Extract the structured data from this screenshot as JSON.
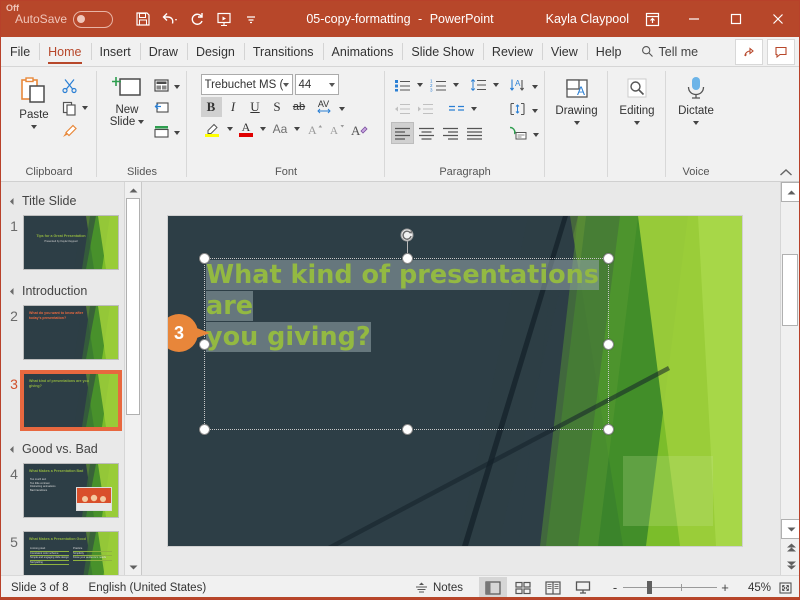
{
  "titlebar": {
    "autosave_label": "AutoSave",
    "autosave_state": "Off",
    "filename": "05-copy-formatting",
    "separator": "-",
    "app_name": "PowerPoint",
    "user_name": "Kayla Claypool",
    "qat": [
      {
        "name": "save-icon",
        "tip": "Save"
      },
      {
        "name": "undo-icon",
        "tip": "Undo"
      },
      {
        "name": "redo-icon",
        "tip": "Redo"
      },
      {
        "name": "start-presentation-icon",
        "tip": "Start From Beginning"
      },
      {
        "name": "customize-qat-icon",
        "tip": "Customize Quick Access Toolbar"
      }
    ],
    "window_buttons": [
      "ribbon-display-options",
      "minimize",
      "maximize",
      "close"
    ],
    "accent_color": "#b7472a"
  },
  "tabs": [
    {
      "label": "File",
      "active": false
    },
    {
      "label": "Home",
      "active": true
    },
    {
      "label": "Insert",
      "active": false
    },
    {
      "label": "Draw",
      "active": false
    },
    {
      "label": "Design",
      "active": false
    },
    {
      "label": "Transitions",
      "active": false
    },
    {
      "label": "Animations",
      "active": false
    },
    {
      "label": "Slide Show",
      "active": false
    },
    {
      "label": "Review",
      "active": false
    },
    {
      "label": "View",
      "active": false
    },
    {
      "label": "Help",
      "active": false
    }
  ],
  "tellme": {
    "label": "Tell me"
  },
  "ribbon": {
    "groups": [
      {
        "label": "Clipboard",
        "has_dialog_launcher": true
      },
      {
        "label": "Slides",
        "has_dialog_launcher": false
      },
      {
        "label": "Font",
        "has_dialog_launcher": true
      },
      {
        "label": "Paragraph",
        "has_dialog_launcher": true
      },
      {
        "label": "",
        "has_dialog_launcher": false
      },
      {
        "label": "",
        "has_dialog_launcher": false
      },
      {
        "label": "Voice",
        "has_dialog_launcher": false
      }
    ],
    "clipboard": {
      "paste_label": "Paste",
      "cut_tip": "Cut",
      "copy_tip": "Copy",
      "format_painter_tip": "Format Painter"
    },
    "slides": {
      "new_slide_label": "New\nSlide",
      "new_slide_line1": "New",
      "new_slide_line2": "Slide",
      "layout_tip": "Layout",
      "reset_tip": "Reset",
      "section_tip": "Section"
    },
    "font": {
      "font_name": "Trebuchet MS (Heading)",
      "font_size": "44",
      "bold": "B",
      "italic": "I",
      "underline": "U",
      "strikethrough": "S",
      "text_shadow": "ab",
      "character_spacing": "AV",
      "bold_active": true,
      "highlight_color": "#ffff00",
      "font_color": "#e00000",
      "change_case": "Aa",
      "increase_size": "A",
      "decrease_size": "A",
      "clear_formatting": "A"
    },
    "paragraph": {
      "bullets_tip": "Bullets",
      "numbering_tip": "Numbering",
      "line_spacing_tip": "Line Spacing",
      "text_direction_tip": "Text Direction",
      "decrease_indent_tip": "Decrease List Level",
      "increase_indent_tip": "Increase List Level",
      "columns_tip": "Add or Remove Columns",
      "align_text_tip": "Align Text",
      "align_left_active": true,
      "convert_smartart_tip": "Convert to SmartArt"
    },
    "drawing": {
      "label": "Drawing"
    },
    "editing": {
      "label": "Editing"
    },
    "dictate": {
      "label": "Dictate"
    }
  },
  "thumbnails": {
    "sections": [
      {
        "title": "Title Slide",
        "slides": [
          {
            "number": "1",
            "selected": false,
            "kind": "title",
            "title_text": "Tips for a Great Presentation",
            "subtitle_text": "Presented by Kayla Claypool",
            "title_color": "#8fb33f"
          }
        ]
      },
      {
        "title": "Introduction",
        "slides": [
          {
            "number": "2",
            "selected": false,
            "kind": "heading",
            "title_text": "What do you want to know after today's presentation?",
            "title_color": "#e8683f"
          },
          {
            "number": "3",
            "selected": true,
            "kind": "heading",
            "title_text": "What kind of presentations are you giving?",
            "title_color": "#8fb33f"
          }
        ]
      },
      {
        "title": "Good vs. Bad",
        "slides": [
          {
            "number": "4",
            "selected": false,
            "kind": "bullets-image",
            "title_text": "What Makes a Presentation Bad",
            "title_color": "#8fb33f",
            "bullets": [
              "Too much text",
              "Too little contrast",
              "Distracting animations",
              "Bad transitions"
            ]
          },
          {
            "number": "5",
            "selected": false,
            "kind": "two-column",
            "title_text": "What Makes a Presentation Good",
            "title_color": "#8fb33f",
            "col_left": [
              "A strong start",
              "Consistent color scheme",
              "Simple and engaging slide design",
              "Storytelling"
            ],
            "col_right": [
              "Practice",
              "Simplicity",
              "Know your audience's needs"
            ]
          }
        ]
      }
    ]
  },
  "slide": {
    "title_text": "What kind of presentations are you giving?",
    "title_line1": "What kind of presentations are",
    "title_line2": "you giving?",
    "title_color": "#93b942",
    "background_color": "#2d3e46",
    "callout_number": "3",
    "callout_color": "#e8863a",
    "selection_active": true
  },
  "status": {
    "slide_indicator": "Slide 3 of 8",
    "language": "English (United States)",
    "notes_label": "Notes",
    "views": [
      {
        "name": "normal-view",
        "active": true
      },
      {
        "name": "slide-sorter-view",
        "active": false
      },
      {
        "name": "reading-view",
        "active": false
      },
      {
        "name": "slide-show-view",
        "active": false
      }
    ],
    "zoom_minus": "-",
    "zoom_plus": "+",
    "zoom_level": "45%",
    "fit_slide_tip": "Fit slide to current window"
  }
}
